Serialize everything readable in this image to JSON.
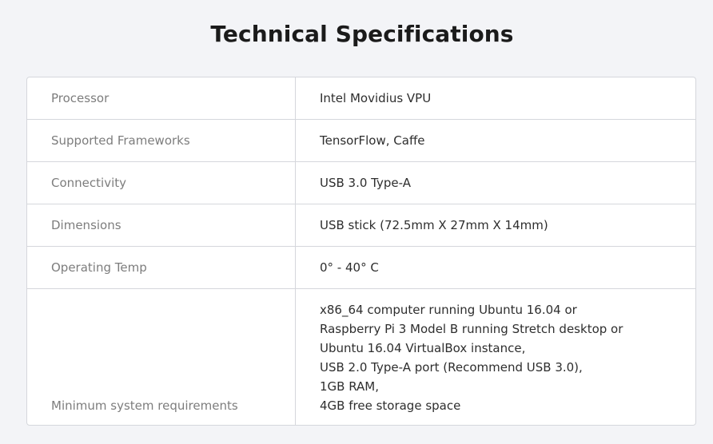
{
  "heading": "Technical Specifications",
  "specs": [
    {
      "label": "Processor",
      "value": "Intel Movidius VPU"
    },
    {
      "label": "Supported Frameworks",
      "value": "TensorFlow, Caffe"
    },
    {
      "label": "Connectivity",
      "value": "USB 3.0 Type-A"
    },
    {
      "label": "Dimensions",
      "value": "USB stick (72.5mm X 27mm X 14mm)"
    },
    {
      "label": "Operating Temp",
      "value": "0° - 40° C"
    }
  ],
  "requirements": {
    "label": "Minimum system requirements",
    "lines": [
      "x86_64 computer running Ubuntu 16.04 or",
      "Raspberry Pi 3 Model B running Stretch desktop or",
      "Ubuntu 16.04 VirtualBox instance,",
      "USB 2.0 Type-A port (Recommend USB 3.0),",
      "1GB RAM,",
      "4GB free storage space"
    ]
  }
}
